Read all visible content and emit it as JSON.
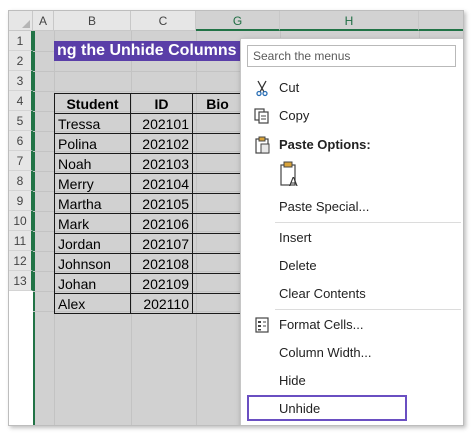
{
  "columns": [
    "A",
    "B",
    "C",
    "G",
    "H"
  ],
  "rows": [
    "1",
    "2",
    "3",
    "4",
    "5",
    "6",
    "7",
    "8",
    "9",
    "10",
    "11",
    "12",
    "13"
  ],
  "title_cell": "ng the Unhide Columns",
  "table": {
    "headers": [
      "Student",
      "ID",
      "Bio"
    ],
    "rows": [
      [
        "Tressa",
        "202101"
      ],
      [
        "Polina",
        "202102"
      ],
      [
        "Noah",
        "202103"
      ],
      [
        "Merry",
        "202104"
      ],
      [
        "Martha",
        "202105"
      ],
      [
        "Mark",
        "202106"
      ],
      [
        "Jordan",
        "202107"
      ],
      [
        "Johnson",
        "202108"
      ],
      [
        "Johan",
        "202109"
      ],
      [
        "Alex",
        "202110"
      ]
    ]
  },
  "menu": {
    "search_placeholder": "Search the menus",
    "cut": "Cut",
    "copy": "Copy",
    "paste_options": "Paste Options:",
    "paste_special": "Paste Special...",
    "insert": "Insert",
    "delete": "Delete",
    "clear_contents": "Clear Contents",
    "format_cells": "Format Cells...",
    "column_width": "Column Width...",
    "hide": "Hide",
    "unhide": "Unhide"
  },
  "colors": {
    "accent": "#217346",
    "title_fill": "#5a3ea8",
    "highlight_border": "#6a4fc2",
    "selection_fill": "#d1d1d1"
  }
}
